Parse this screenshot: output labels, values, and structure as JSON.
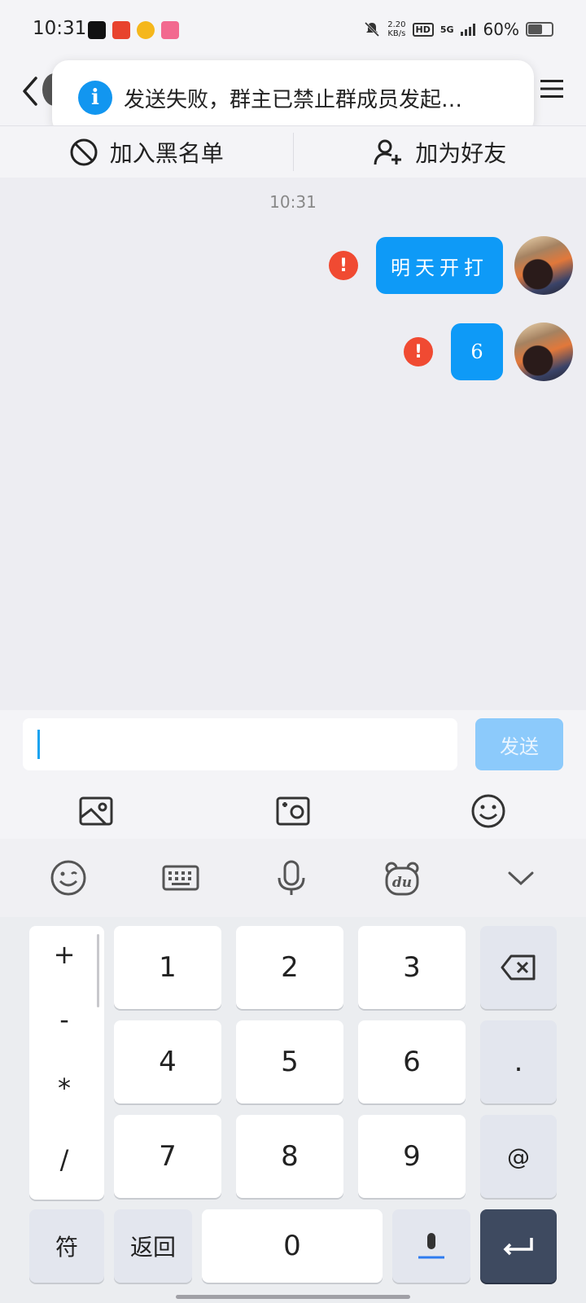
{
  "status_bar": {
    "time": "10:31",
    "netspeed_value": "2.20",
    "netspeed_unit": "KB/s",
    "hd": "HD",
    "network": "5G",
    "battery": "60%",
    "battery_level": 0.6
  },
  "toast": {
    "text": "发送失败，群主已禁止群成员发起…"
  },
  "actions": {
    "blacklist": "加入黑名单",
    "add_friend": "加为好友"
  },
  "chat": {
    "timestamp": "10:31",
    "messages": [
      {
        "text": "明天开打",
        "status": "failed"
      },
      {
        "text": "6",
        "status": "failed"
      }
    ],
    "error_glyph": "!"
  },
  "input": {
    "value": "",
    "send_label": "发送"
  },
  "keyboard": {
    "symbols": [
      "+",
      "-",
      "*",
      "/"
    ],
    "digits": [
      "1",
      "2",
      "3",
      "4",
      "5",
      "6",
      "7",
      "8",
      "9",
      "0"
    ],
    "dot": ".",
    "at": "@",
    "fu": "符",
    "back": "返回"
  },
  "colors": {
    "bubble": "#0e9af7",
    "error": "#f04a32",
    "send_disabled": "#8ccafb",
    "info": "#1296f0"
  }
}
